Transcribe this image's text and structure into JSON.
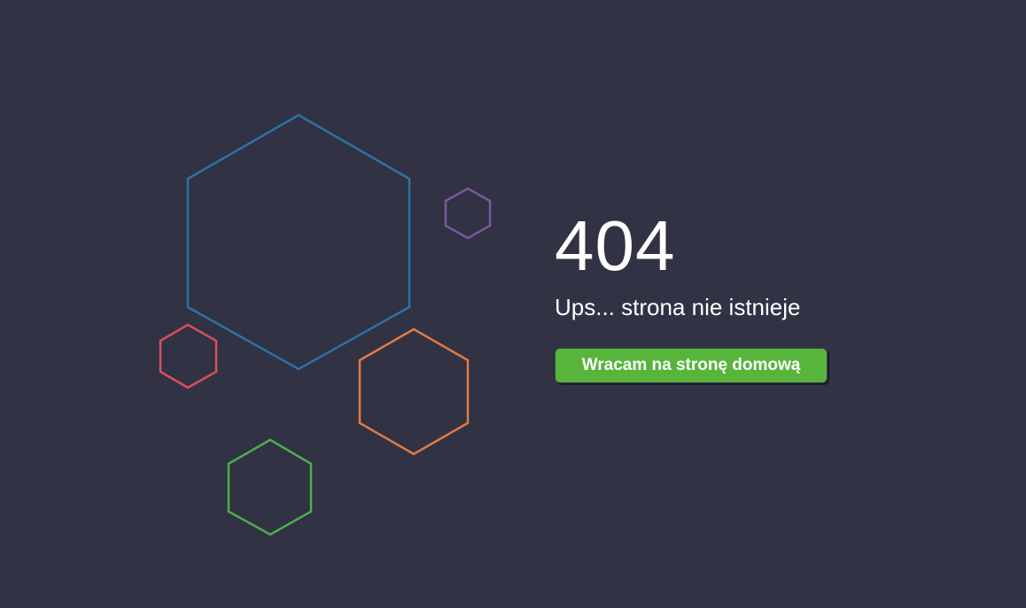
{
  "error": {
    "code": "404",
    "message": "Ups... strona nie istnieje"
  },
  "actions": {
    "home_button_label": "Wracam na stronę domową"
  },
  "colors": {
    "background": "#313243",
    "hex_blue": "#2f71a8",
    "hex_purple": "#7a5a9c",
    "hex_red": "#d6505e",
    "hex_orange": "#e07b45",
    "hex_green": "#4ead4f",
    "button": "#58b53b",
    "text": "#ffffff"
  }
}
